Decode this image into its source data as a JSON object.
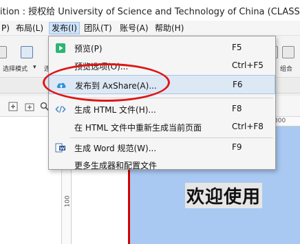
{
  "window": {
    "title": "ition : 授权给 University of Science and Technology of China (CLASSROOM)"
  },
  "menubar": {
    "items": [
      "P)",
      "布局(L)",
      "发布(I)",
      "团队(T)",
      "账号(A)",
      "帮助(H)"
    ],
    "active_index": 2
  },
  "toolbar": {
    "select_mode_label": "选择模式",
    "cut_label": "连",
    "group_label": "组合"
  },
  "ruler": {
    "top_mark": "300",
    "left_mark": "100"
  },
  "canvas": {
    "banner_text": "欢迎使用"
  },
  "publish_menu": {
    "items": [
      {
        "label": "预览(P)",
        "shortcut": "F5",
        "icon": "preview-play-icon"
      },
      {
        "label": "预览选项(O)...",
        "shortcut": "Ctrl+F5",
        "icon": ""
      },
      {
        "label": "发布到 AxShare(A)...",
        "shortcut": "F6",
        "icon": "cloud-upload-icon",
        "highlighted": true
      },
      {
        "label": "生成 HTML 文件(H)...",
        "shortcut": "F8",
        "icon": "code-brackets-icon"
      },
      {
        "label": "在 HTML 文件中重新生成当前页面",
        "shortcut": "Ctrl+F8",
        "icon": ""
      },
      {
        "label": "生成 Word 规范(W)...",
        "shortcut": "F9",
        "icon": "word-spec-icon"
      },
      {
        "label": "更多生成器和配置文件",
        "shortcut": "",
        "icon": ""
      }
    ]
  },
  "colors": {
    "annotation": "#e01515",
    "highlight": "#dde8f5",
    "banner": "#a9c9f2",
    "preview_icon": "#2bb673",
    "cloud_icon": "#2f8fd8"
  }
}
